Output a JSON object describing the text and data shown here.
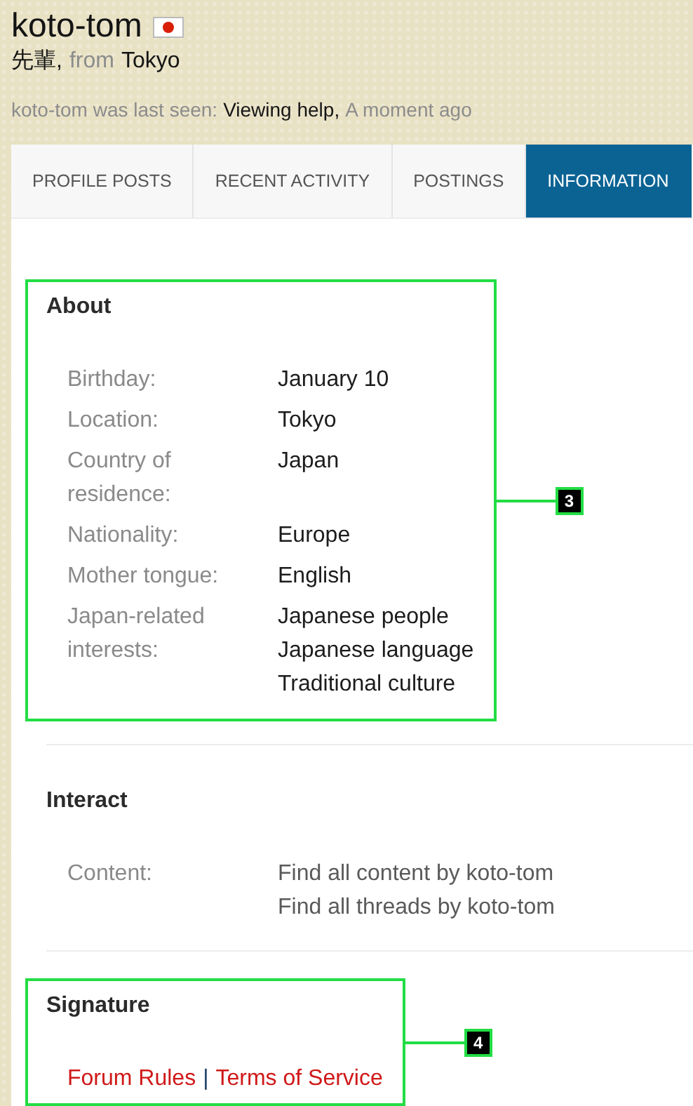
{
  "profile": {
    "username": "koto-tom",
    "rank": "先輩,",
    "from_label": "from",
    "location": "Tokyo",
    "last_seen": {
      "prefix": "koto-tom was last seen:",
      "activity": "Viewing help,",
      "time": "A moment ago"
    }
  },
  "tabs": [
    {
      "label": "PROFILE POSTS",
      "selected": false
    },
    {
      "label": "RECENT ACTIVITY",
      "selected": false
    },
    {
      "label": "POSTINGS",
      "selected": false
    },
    {
      "label": "INFORMATION",
      "selected": true
    }
  ],
  "sections": [
    {
      "kind": "fields",
      "title": "About",
      "annotation": "3",
      "rows": [
        {
          "kind": "text",
          "label": "Birthday:",
          "values": [
            "January 10"
          ]
        },
        {
          "kind": "text",
          "label": "Location:",
          "values": [
            "Tokyo"
          ]
        },
        {
          "kind": "text",
          "label": "Country of residence:",
          "values": [
            "Japan"
          ]
        },
        {
          "kind": "text",
          "label": "Nationality:",
          "values": [
            "Europe"
          ]
        },
        {
          "kind": "text",
          "label": "Mother tongue:",
          "values": [
            "English"
          ]
        },
        {
          "kind": "text",
          "label": "Japan-related interests:",
          "values": [
            "Japanese people",
            "Japanese language",
            "Traditional culture"
          ]
        }
      ]
    },
    {
      "kind": "fields",
      "title": "Interact",
      "rows": [
        {
          "kind": "link",
          "label": "Content:",
          "values": [
            "Find all content by koto-tom",
            "Find all threads by koto-tom"
          ]
        }
      ]
    },
    {
      "kind": "links",
      "title": "Signature",
      "annotation": "4",
      "links": [
        "Forum Rules",
        "Terms of Service"
      ],
      "separator": "|"
    }
  ]
}
